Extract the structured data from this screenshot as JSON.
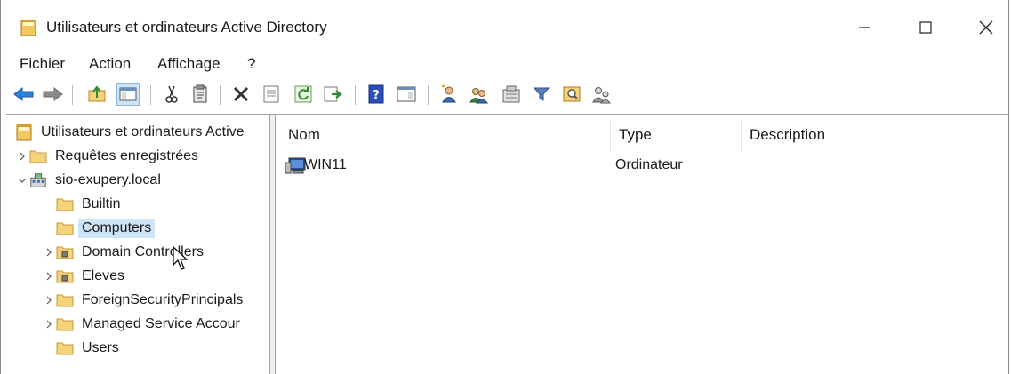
{
  "window": {
    "title": "Utilisateurs et ordinateurs Active Directory",
    "controls": {
      "minimize": "minimize",
      "maximize": "maximize",
      "close": "close"
    }
  },
  "menu": [
    "Fichier",
    "Action",
    "Affichage",
    "?"
  ],
  "toolbar": {
    "icons": [
      "back-arrow-icon",
      "forward-arrow-icon",
      "up-folder-icon",
      "show-hide-console-tree-icon",
      "cut-icon",
      "paste-icon",
      "delete-icon",
      "properties-icon",
      "refresh-icon",
      "export-list-icon",
      "help-icon",
      "action-pane-icon",
      "new-user-icon",
      "new-group-icon",
      "new-ou-icon",
      "filter-icon",
      "find-icon",
      "delegate-icon"
    ]
  },
  "tree": {
    "root": "Utilisateurs et ordinateurs Active",
    "items": [
      {
        "label": "Requêtes enregistrées",
        "expand": "collapsed",
        "level": 1,
        "icon": "folder"
      },
      {
        "label": "sio-exupery.local",
        "expand": "expanded",
        "level": 1,
        "icon": "domain"
      },
      {
        "label": "Builtin",
        "expand": "none",
        "level": 2,
        "icon": "folder"
      },
      {
        "label": "Computers",
        "expand": "none",
        "level": 2,
        "icon": "folder",
        "selected": true
      },
      {
        "label": "Domain Controllers",
        "expand": "collapsed",
        "level": 2,
        "icon": "ou"
      },
      {
        "label": "Eleves",
        "expand": "collapsed",
        "level": 2,
        "icon": "ou"
      },
      {
        "label": "ForeignSecurityPrincipals",
        "expand": "collapsed",
        "level": 2,
        "icon": "folder"
      },
      {
        "label": "Managed Service Accour",
        "expand": "collapsed",
        "level": 2,
        "icon": "folder"
      },
      {
        "label": "Users",
        "expand": "none",
        "level": 2,
        "icon": "folder"
      }
    ]
  },
  "list": {
    "columns": [
      "Nom",
      "Type",
      "Description"
    ],
    "rows": [
      {
        "name": "WIN11",
        "type": "Ordinateur",
        "description": ""
      }
    ]
  },
  "colors": {
    "selection": "#cde5f7",
    "accent": "#1e6fd6",
    "folder": "#f6d27a"
  }
}
